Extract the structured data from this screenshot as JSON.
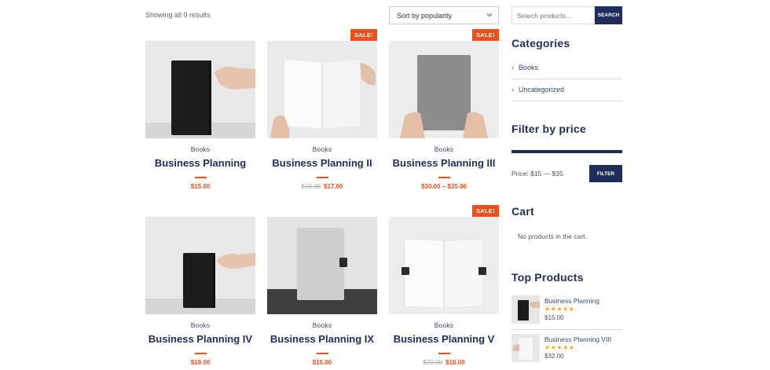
{
  "toolbar": {
    "results_text": "Showing all 9 results",
    "sort_selected": "Sort by popularity"
  },
  "products": [
    {
      "category": "Books",
      "title": "Business Planning",
      "price": "$15.00",
      "old_price": "",
      "sale": ""
    },
    {
      "category": "Books",
      "title": "Business Planning II",
      "price": "$17.00",
      "old_price": "$19.00",
      "sale": "SALE!"
    },
    {
      "category": "Books",
      "title": "Business Planning III",
      "price": "$30.00 – $35.00",
      "old_price": "",
      "sale": "SALE!"
    },
    {
      "category": "Books",
      "title": "Business Planning IV",
      "price": "$19.00",
      "old_price": "",
      "sale": ""
    },
    {
      "category": "Books",
      "title": "Business Planning IX",
      "price": "$15.00",
      "old_price": "",
      "sale": ""
    },
    {
      "category": "Books",
      "title": "Business Planning V",
      "price": "$18.00",
      "old_price": "$20.00",
      "sale": "SALE!"
    }
  ],
  "sidebar": {
    "search_placeholder": "Search products…",
    "search_button": "SEARCH",
    "categories_title": "Categories",
    "categories": [
      {
        "label": "Books"
      },
      {
        "label": "Uncategorized"
      }
    ],
    "filter_title": "Filter by price",
    "price_range": "Price: $15 — $35",
    "filter_button": "FILTER",
    "cart_title": "Cart",
    "cart_empty": "No products in the cart.",
    "top_products_title": "Top Products",
    "top_products": [
      {
        "name": "Business Planning",
        "rating": 5,
        "stars": "★★★★★",
        "price": "$15.00"
      },
      {
        "name": "Business Planning VIII",
        "rating": 5,
        "stars": "★★★★★",
        "price": "$32.00"
      }
    ]
  },
  "colors": {
    "navy": "#1f2d5c",
    "accent": "#f04e1b"
  }
}
